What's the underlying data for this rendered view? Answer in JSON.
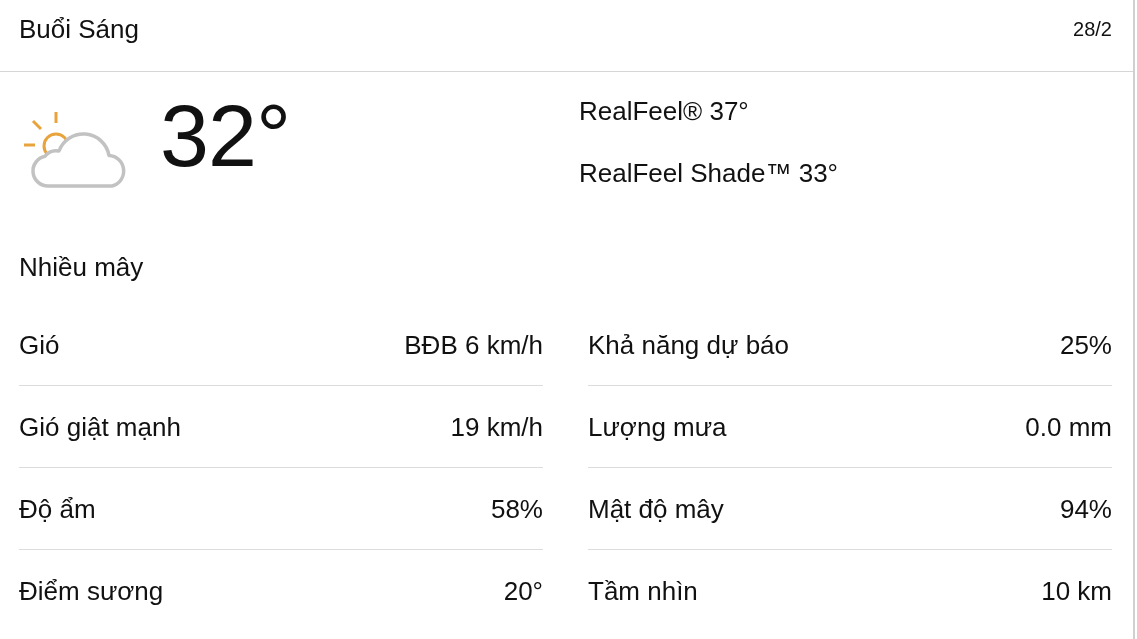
{
  "header": {
    "title": "Buổi Sáng",
    "date": "28/2"
  },
  "current": {
    "temperature": "32°",
    "realfeel": [
      "RealFeel® 37°",
      "RealFeel Shade™ 33°"
    ]
  },
  "condition": "Nhiều mây",
  "details": [
    {
      "label": "Gió",
      "value": "BĐB 6 km/h"
    },
    {
      "label": "Khả năng dự báo",
      "value": "25%"
    },
    {
      "label": "Gió giật mạnh",
      "value": "19 km/h"
    },
    {
      "label": "Lượng mưa",
      "value": "0.0 mm"
    },
    {
      "label": "Độ ẩm",
      "value": "58%"
    },
    {
      "label": "Mật độ mây",
      "value": "94%"
    },
    {
      "label": "Điểm sương",
      "value": "20°"
    },
    {
      "label": "Tầm nhìn",
      "value": "10 km"
    }
  ]
}
